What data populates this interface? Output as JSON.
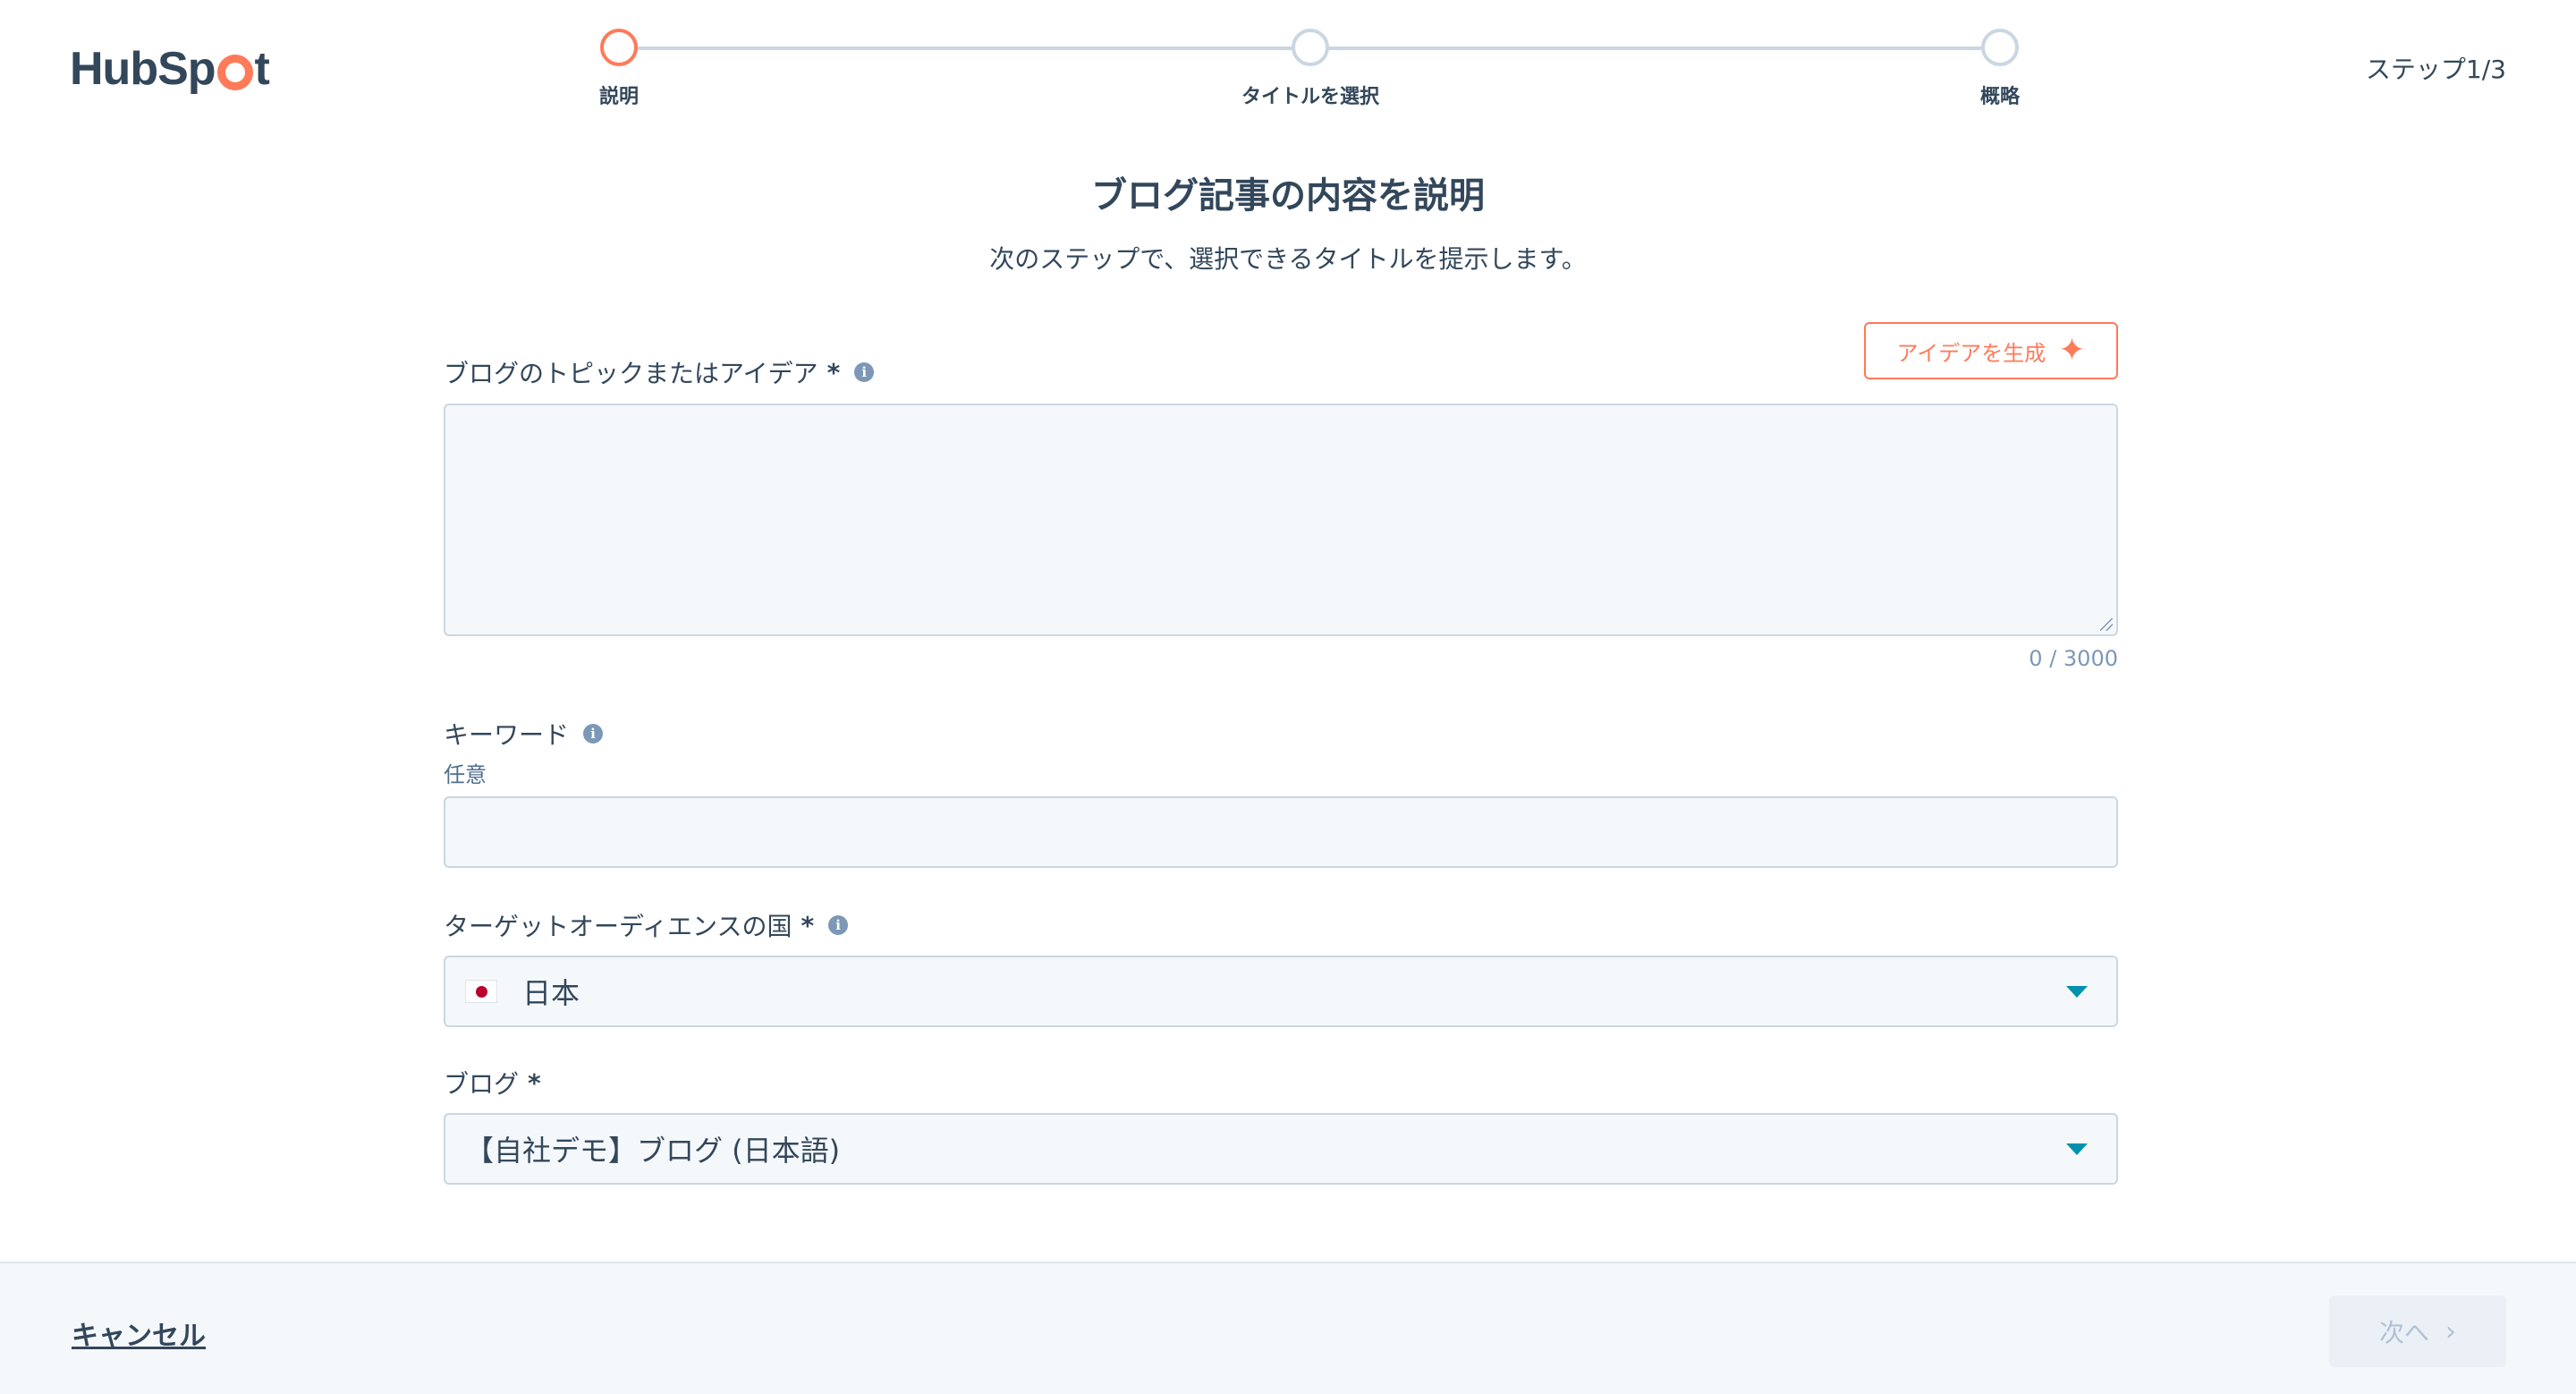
{
  "header": {
    "logo_text_left": "HubSp",
    "logo_text_right": "t",
    "step_counter": "ステップ1/3"
  },
  "stepper": {
    "steps": [
      {
        "label": "説明",
        "state": "active"
      },
      {
        "label": "タイトルを選択",
        "state": "inactive"
      },
      {
        "label": "概略",
        "state": "inactive"
      }
    ]
  },
  "page": {
    "title": "ブログ記事の内容を説明",
    "subtitle": "次のステップで、選択できるタイトルを提示します。"
  },
  "form": {
    "topic": {
      "label": "ブログのトピックまたはアイデア",
      "required_mark": "*",
      "value": "",
      "char_count": "0 / 3000"
    },
    "generate_button": {
      "label": "アイデアを生成",
      "icon": "sparkle-icon"
    },
    "keyword": {
      "label": "キーワード",
      "help": "任意",
      "value": ""
    },
    "country": {
      "label": "ターゲットオーディエンスの国",
      "required_mark": "*",
      "selected": "日本",
      "flag_icon": "japan-flag-icon"
    },
    "blog": {
      "label": "ブログ",
      "required_mark": "*",
      "selected": "【自社デモ】ブログ (日本語)"
    }
  },
  "footer": {
    "cancel_label": "キャンセル",
    "next_label": "次へ",
    "next_enabled": false
  },
  "colors": {
    "accent": "#ff7a59",
    "text": "#33475b",
    "border": "#cbd6e2",
    "input_bg": "#f5f8fa",
    "caret": "#0091ae"
  }
}
